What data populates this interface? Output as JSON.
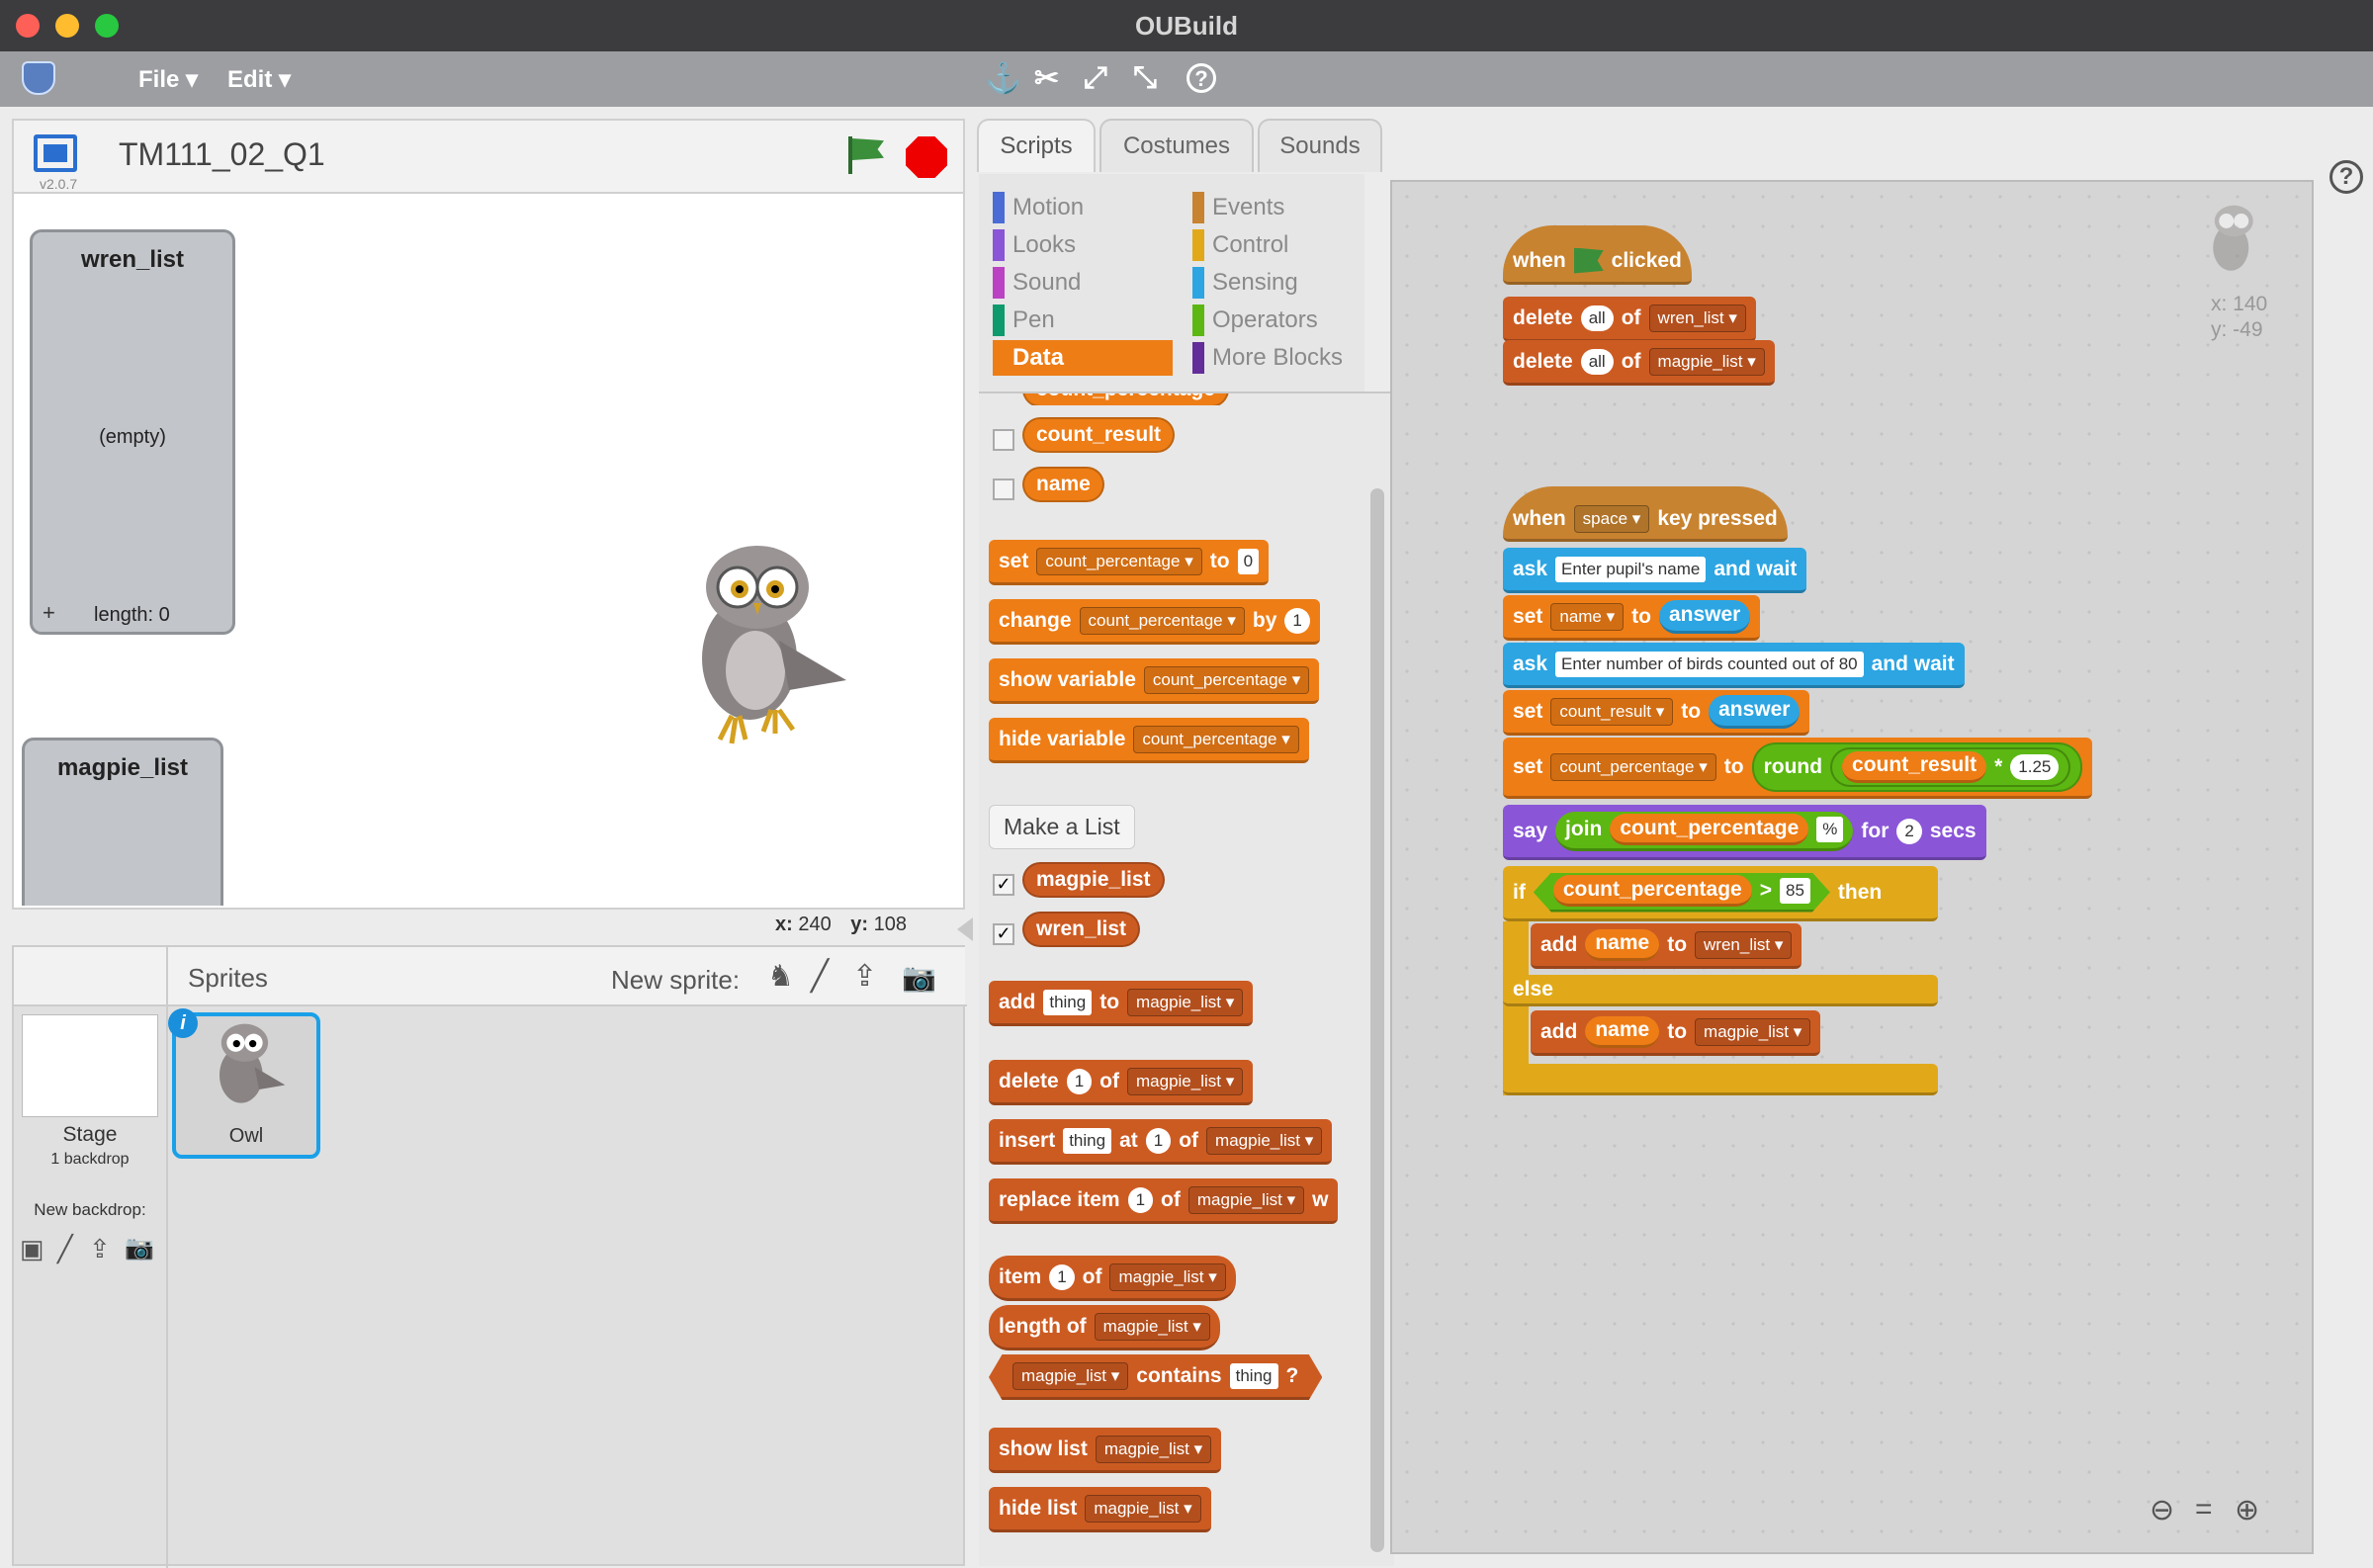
{
  "window": {
    "title": "OUBuild"
  },
  "menu": {
    "file": "File ▾",
    "edit": "Edit ▾"
  },
  "stage": {
    "project_title": "TM111_02_Q1",
    "version": "v2.0.7",
    "coords": {
      "x_label": "x:",
      "x_value": "240",
      "y_label": "y:",
      "y_value": "108"
    },
    "wren_monitor": {
      "name": "wren_list",
      "content": "(empty)",
      "length": "length: 0"
    },
    "magpie_monitor": {
      "name": "magpie_list"
    }
  },
  "sprites_pane": {
    "title": "Sprites",
    "new_sprite": "New sprite:",
    "stage_label": "Stage",
    "stage_sub": "1 backdrop",
    "new_backdrop": "New backdrop:",
    "sprite_name": "Owl"
  },
  "tabs": [
    "Scripts",
    "Costumes",
    "Sounds"
  ],
  "categories": {
    "motion": "Motion",
    "looks": "Looks",
    "sound": "Sound",
    "pen": "Pen",
    "data": "Data",
    "events": "Events",
    "control": "Control",
    "sensing": "Sensing",
    "operators": "Operators",
    "more": "More Blocks"
  },
  "palette": {
    "var_partial": "count_percentage",
    "var_result": "count_result",
    "var_name": "name",
    "set": "set",
    "change": "change",
    "by": "by",
    "to": "to",
    "show_variable": "show variable",
    "hide_variable": "hide variable",
    "var_dd": "count_percentage",
    "zero": "0",
    "one": "1",
    "make_list": "Make a List",
    "magpie_list": "magpie_list",
    "wren_list": "wren_list",
    "add": "add",
    "thing": "thing",
    "delete": "delete",
    "of": "of",
    "insert": "insert",
    "at": "at",
    "replace_item": "replace item",
    "w": "w",
    "item": "item",
    "length_of": "length of",
    "contains": "contains",
    "q": "?",
    "show_list": "show list",
    "hide_list": "hide list"
  },
  "scripts": {
    "sprite_x": "x: 140",
    "sprite_y": "y: -49",
    "when": "when",
    "clicked": "clicked",
    "delete": "delete",
    "all": "all",
    "of": "of",
    "wren_list": "wren_list",
    "magpie_list": "magpie_list",
    "space": "space",
    "key_pressed": "key pressed",
    "ask": "ask",
    "and_wait": "and wait",
    "ask1_text": "Enter pupil's name",
    "ask2_text": "Enter number of birds counted out of 80",
    "set": "set",
    "to": "to",
    "name": "name",
    "answer": "answer",
    "count_result": "count_result",
    "count_percentage": "count_percentage",
    "round": "round",
    "times": "*",
    "factor": "1.25",
    "say": "say",
    "join": "join",
    "percent": "%",
    "for": "for",
    "secs_value": "2",
    "secs": "secs",
    "if": "if",
    "gt": ">",
    "threshold": "85",
    "then": "then",
    "add": "add",
    "else": "else"
  }
}
